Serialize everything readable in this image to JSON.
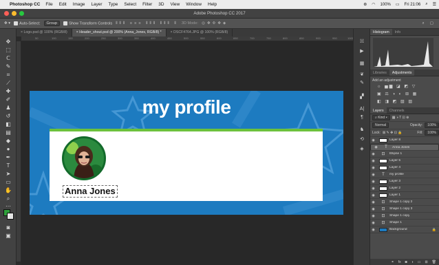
{
  "menubar": {
    "app_name": "Photoshop CC",
    "items": [
      "File",
      "Edit",
      "Image",
      "Layer",
      "Type",
      "Select",
      "Filter",
      "3D",
      "View",
      "Window",
      "Help"
    ],
    "battery": "100%",
    "clock": "Fri 21:06"
  },
  "window": {
    "title": "Adobe Photoshop CC 2017"
  },
  "options": {
    "auto_select_label": "Auto-Select:",
    "auto_select_value": "Group",
    "transform_label": "Show Transform Controls",
    "mode_label": "3D Mode:"
  },
  "tabs": [
    {
      "label": "Logo.psd @ 100% (RGB/8)",
      "active": false
    },
    {
      "label": "Header_shout.psd @ 200% (Anna_Jones, RGB/8) *",
      "active": true
    },
    {
      "label": "DSCF4764.JPG @ 100% (RGB/8)",
      "active": false
    }
  ],
  "ruler_marks": [
    "50",
    "100",
    "150",
    "200",
    "250",
    "300",
    "350",
    "400",
    "450",
    "500",
    "550",
    "600",
    "650",
    "700",
    "750",
    "800",
    "850",
    "900",
    "950",
    "1000"
  ],
  "document": {
    "headline": "my profile",
    "name": "Anna Jones",
    "colors": {
      "background": "#1d7bc0",
      "accent": "#6cc13c",
      "card": "#ffffff"
    }
  },
  "panels": {
    "top_tabs": [
      "Histogram",
      "Info"
    ],
    "mid_tabs": [
      "Libraries",
      "Adjustments"
    ],
    "add_adjustment": "Add an adjustment",
    "layer_tabs": [
      "Layers",
      "Channels"
    ],
    "kind_label": "Kind",
    "blend_mode": "Normal",
    "opacity_label": "Opacity:",
    "opacity_value": "100%",
    "lock_label": "Lock:",
    "fill_label": "Fill:",
    "fill_value": "100%"
  },
  "layers": [
    {
      "name": "Layer 8",
      "thumb": "white",
      "selected": false
    },
    {
      "name": "Anna Jones",
      "thumb": "text",
      "selected": true
    },
    {
      "name": "Ellipse 1",
      "thumb": "shape",
      "selected": false
    },
    {
      "name": "Layer 5",
      "thumb": "white",
      "selected": false
    },
    {
      "name": "Layer 4",
      "thumb": "white",
      "selected": false
    },
    {
      "name": "my profile",
      "thumb": "text",
      "selected": false
    },
    {
      "name": "Layer 3",
      "thumb": "white",
      "selected": false
    },
    {
      "name": "Layer 2",
      "thumb": "white",
      "selected": false
    },
    {
      "name": "Layer 1",
      "thumb": "white",
      "selected": false
    },
    {
      "name": "Shape 1 copy 2",
      "thumb": "shape",
      "selected": false
    },
    {
      "name": "Shape 1 copy 3",
      "thumb": "shape",
      "selected": false
    },
    {
      "name": "Shape 1 copy",
      "thumb": "shape",
      "selected": false
    },
    {
      "name": "Shape 1",
      "thumb": "shape",
      "selected": false
    },
    {
      "name": "Background",
      "thumb": "blue",
      "selected": false,
      "locked": true
    }
  ]
}
